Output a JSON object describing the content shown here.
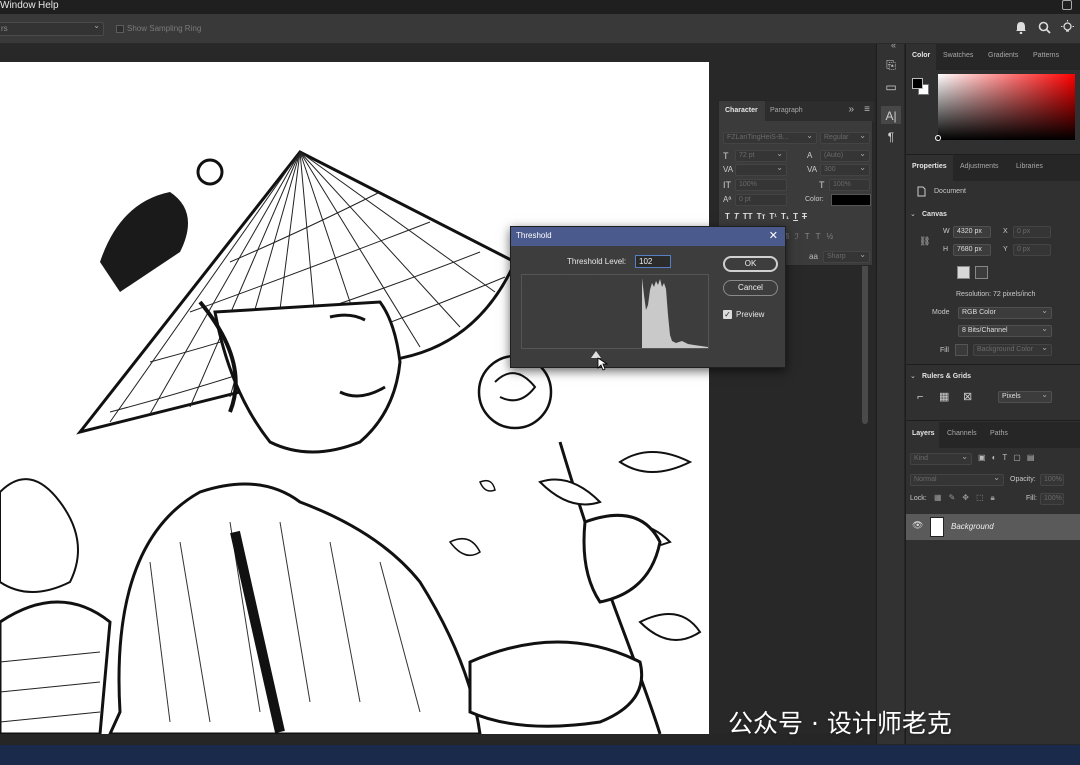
{
  "menubar": {
    "items": [
      "Window",
      "Help"
    ]
  },
  "options_bar": {
    "sample_select": "rs",
    "show_sampling_ring": "Show Sampling Ring"
  },
  "character_panel": {
    "tabs": [
      "Character",
      "Paragraph"
    ],
    "font_family": "FZLanTingHeiS-B...",
    "font_style": "Regular",
    "font_size": "72 pt",
    "leading": "(Auto)",
    "tracking": "300",
    "vscale": "100%",
    "hscale": "100%",
    "baseline": "0 pt",
    "color_label": "Color:",
    "antialias_lang": "aa",
    "antialias": "Sharp"
  },
  "threshold_dialog": {
    "title": "Threshold",
    "level_label": "Threshold Level:",
    "level_value": "102",
    "ok": "OK",
    "cancel": "Cancel",
    "preview_label": "Preview",
    "preview_checked": true,
    "threshold_fraction": 0.4
  },
  "color_panel": {
    "tabs": [
      "Color",
      "Swatches",
      "Gradients",
      "Patterns"
    ]
  },
  "properties_panel": {
    "tabs": [
      "Properties",
      "Adjustments",
      "Libraries"
    ],
    "doc_label": "Document",
    "canvas_title": "Canvas",
    "w_label": "W",
    "w_value": "4320 px",
    "h_label": "H",
    "h_value": "7680 px",
    "x_label": "X",
    "x_value": "0 px",
    "y_label": "Y",
    "y_value": "0 px",
    "resolution": "Resolution: 72 pixels/inch",
    "mode_label": "Mode",
    "mode_value": "RGB Color",
    "bits_value": "8 Bits/Channel",
    "fill_label": "Fill",
    "fill_value": "Background Color",
    "rulers_title": "Rulers & Grids",
    "units_value": "Pixels"
  },
  "layers_panel": {
    "tabs": [
      "Layers",
      "Channels",
      "Paths"
    ],
    "kind_label": "Kind",
    "blend_mode": "Normal",
    "opacity_label": "Opacity:",
    "opacity_value": "100%",
    "lock_label": "Lock:",
    "fill_label": "Fill:",
    "fill_value": "100%",
    "layer_name": "Background"
  },
  "watermark": {
    "text": "公众号 · 设计师老克"
  },
  "colors": {
    "dialog_title_bg": "#4b5a8c",
    "panel_bg": "#303030",
    "canvas": "#ffffff",
    "histogram": "#c9c9c9"
  }
}
